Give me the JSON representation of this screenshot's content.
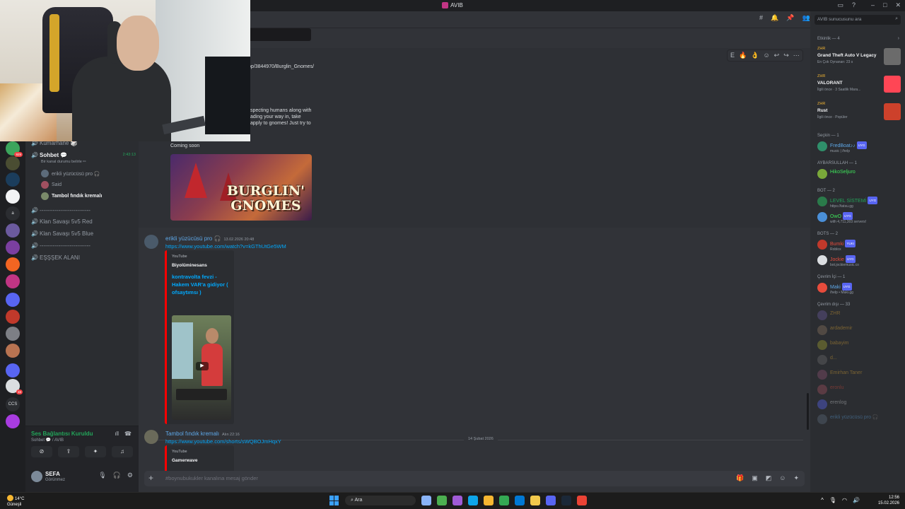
{
  "window": {
    "title": "AVIB"
  },
  "server_rail": {
    "items": [
      {
        "color": "#3ba55c",
        "badge": "929"
      },
      {
        "color": "#4a4d32"
      },
      {
        "color": "#1b3d5c"
      },
      {
        "color": "#f2f3f5"
      },
      {
        "color": "#2b2d31",
        "letter": "a"
      },
      {
        "color": "#6b5a9e"
      },
      {
        "color": "#7b3fa0"
      },
      {
        "color": "#f26522"
      },
      {
        "color": "#c13584"
      },
      {
        "color": "#5865f2"
      },
      {
        "color": "#c0392b"
      },
      {
        "color": "#7d7f85"
      },
      {
        "color": "#b87351"
      },
      {
        "color": "#5865f2"
      },
      {
        "color": "#dbdee1",
        "badge": "16"
      },
      {
        "color": "#2b2d31",
        "letter": "CCS"
      },
      {
        "color": "#a83ce0"
      }
    ]
  },
  "channels": {
    "items": [
      {
        "label": "Kumarhane 🎲",
        "kind": "voice"
      },
      {
        "label": "Sohbet 💬",
        "kind": "voice",
        "active": true,
        "time": "2:43:13",
        "status": "Bir kanal durumu belirle ✏"
      },
      {
        "label": "---------------------------",
        "kind": "voice"
      },
      {
        "label": "Klan Savaşı 5v5 Red",
        "kind": "voice"
      },
      {
        "label": "Klan Savaşı 5v5 Blue",
        "kind": "voice"
      },
      {
        "label": "---------------------------",
        "kind": "voice"
      },
      {
        "label": "EŞŞŞEK ALANI",
        "kind": "voice"
      }
    ],
    "voice_users": [
      "erikli yüzücüsü pro 🎧",
      "Said",
      "Tambol fındık kremalı"
    ]
  },
  "voice_status": {
    "connected": "Ses Bağlantısı Kuruldu",
    "location": "Sohbet 💬 / AVIB"
  },
  "user": {
    "name": "SEFA",
    "status": "Görünmez"
  },
  "message1": {
    "link_fragment": "op/3844970/Burglin_Gnomes/",
    "desc_lines": [
      "specting humans along with",
      "ading your way in, take",
      "apply to gnomes! Just try to"
    ],
    "coming_soon": "Coming soon",
    "image_title_1": "BURGLIN'",
    "image_title_2": "GNOMES"
  },
  "message2": {
    "author": "erikli yüzücüsü pro 🎧",
    "timestamp": "13.02.2026 20:48",
    "url": "https://www.youtube.com/watch?v=kGThUtGe5WM",
    "provider": "YouTube",
    "embed_author": "Biyolüminesans",
    "embed_title": "kontravolta fevzi - Hakem VAR'a gidiyor ( ofsaytımsı )"
  },
  "date_divider": "14 Şubat 2026",
  "message3": {
    "author": "Tambol fındık kremalı",
    "timestamp": "Alın 22:16",
    "url": "https://www.youtube.com/shorts/sWQBOJmHqxY",
    "provider": "YouTube",
    "embed_author": "Gamerwave"
  },
  "composer": {
    "placeholder": "#boynubukukler kanalına mesaj gönder"
  },
  "members": {
    "search_placeholder": "AVIB sunucusunu ara",
    "activity_label": "Etkinlik — 4",
    "activities": [
      {
        "who": "ZHR",
        "game": "Grand Theft Auto V Legacy",
        "meta": "En Çok Oynanan: 23 s",
        "thumb": "#6b6b6b"
      },
      {
        "who": "ZHR",
        "game": "VALORANT",
        "meta": "İlgili önce · 3 Saatlik Mara...",
        "thumb": "#ff4655"
      },
      {
        "who": "ZHR",
        "game": "Rust",
        "meta": "İlgili önce · Popüler",
        "thumb": "#cd412b"
      }
    ],
    "groups": [
      {
        "label": "Seçkin — 1",
        "members": [
          {
            "name": "FredBoat♪♪",
            "sub": "music | /help",
            "color": "#5ea8e8",
            "av": "#2f8f6a",
            "tag": "UYG"
          }
        ]
      },
      {
        "label": "AYBARSULLAH — 1",
        "members": [
          {
            "name": "HikoSeljuro",
            "sub": "",
            "color": "#3ee65a",
            "av": "#7aa83a"
          }
        ]
      },
      {
        "label": "BOT — 2",
        "members": [
          {
            "name": "LEVEL SİSTEMİ",
            "sub": "https://tatsu.gg",
            "color": "#23a55a",
            "av": "#2a7a4a",
            "tag": "UYG"
          },
          {
            "name": "OwO",
            "sub": "with 4,711,303 servers!",
            "color": "#3ee65a",
            "av": "#4a8fd8",
            "tag": "UYG"
          }
        ]
      },
      {
        "label": "BOTS — 2",
        "members": [
          {
            "name": "Bumki",
            "sub": "Roblox",
            "color": "#e74c3c",
            "av": "#c0392b",
            "tag": "YUKI"
          },
          {
            "name": "Jockie",
            "sub": "bot.jockiemusic.co",
            "color": "#e74c3c",
            "av": "#dbdee1",
            "tag": "UYG"
          }
        ]
      },
      {
        "label": "Çevrim İçi — 1",
        "members": [
          {
            "name": "Maki",
            "sub": "/help • Maki.gg",
            "color": "#5ea8e8",
            "av": "#e74c3c",
            "tag": "UYG"
          }
        ]
      },
      {
        "label": "Çevrim dışı — 33",
        "members": [
          {
            "name": "ZHR",
            "sub": "",
            "color": "#f0b232",
            "av": "#6b5a9e",
            "off": true
          },
          {
            "name": "ardademir",
            "sub": "",
            "color": "#f0b232",
            "av": "#8a7560",
            "off": true
          },
          {
            "name": "babayim",
            "sub": "",
            "color": "#f0b232",
            "av": "#a0a030",
            "off": true
          },
          {
            "name": "d...",
            "sub": "",
            "color": "#f0b232",
            "av": "#6b6b6b",
            "off": true
          },
          {
            "name": "Emirhan Taner",
            "sub": "",
            "color": "#f0b232",
            "av": "#8a5070",
            "off": true
          },
          {
            "name": "eronlu",
            "sub": "",
            "color": "#e74c3c",
            "av": "#a05060",
            "off": true
          },
          {
            "name": "erenlog",
            "sub": "",
            "color": "#dbdee1",
            "av": "#5865f2",
            "off": true
          },
          {
            "name": "erikli yüzücüsü pro 🎧",
            "sub": "",
            "color": "#5ea8e8",
            "av": "#5c6b7a",
            "off": true
          }
        ]
      }
    ]
  },
  "taskbar": {
    "weather_temp": "14°C",
    "weather_desc": "Güneşli",
    "search_label": "Ara",
    "time": "12:56",
    "date": "15.02.2026",
    "apps": [
      "#8ab4f8",
      "#4caf50",
      "#a05bd6",
      "#0ea5e9",
      "#f7b731",
      "#34a853",
      "#0078d4",
      "#f2c94c",
      "#5865f2",
      "#1b2838",
      "#ea4335"
    ]
  }
}
